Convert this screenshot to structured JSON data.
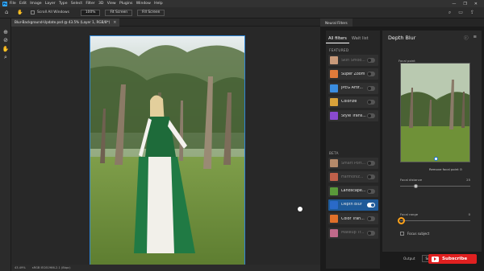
{
  "menubar": {
    "logo": "Ps",
    "items": [
      "File",
      "Edit",
      "Image",
      "Layer",
      "Type",
      "Select",
      "Filter",
      "3D",
      "View",
      "Plugins",
      "Window",
      "Help"
    ],
    "window_controls": [
      "—",
      "❐",
      "✕"
    ]
  },
  "options": {
    "scroll_all_label": "Scroll All Windows",
    "zoom_value": "100%",
    "fit_screen_label": "Fit Screen",
    "fill_screen_label": "Fill Screen"
  },
  "document": {
    "tab_title": "Blur-Background-Update.psd @ 43.5% (Layer 1, RGB/8*)",
    "close": "×"
  },
  "status": {
    "zoom": "43.49%",
    "profile": "sRGB IEC61966-2.1 (8bpc)"
  },
  "neural_filters": {
    "panel_tab": "Neural Filters",
    "tabs": [
      "All filters",
      "Wait list"
    ],
    "featured_label": "FEATURED",
    "beta_label": "BETA",
    "featured": [
      {
        "label": "Skin Smoo...",
        "enabled": false,
        "dim": true,
        "color": "#c99a7a"
      },
      {
        "label": "Super Zoom",
        "enabled": false,
        "dim": false,
        "color": "#e07b3a"
      },
      {
        "label": "JPEG Artif...",
        "enabled": false,
        "dim": false,
        "color": "#3a8de0"
      },
      {
        "label": "Colorize",
        "enabled": false,
        "dim": false,
        "color": "#d9a23a"
      },
      {
        "label": "Style Trans...",
        "enabled": false,
        "dim": false,
        "color": "#8a4ad0"
      }
    ],
    "beta": [
      {
        "label": "Smart Port...",
        "enabled": false,
        "dim": true,
        "color": "#b58a6a"
      },
      {
        "label": "Harmoniz...",
        "enabled": false,
        "dim": true,
        "color": "#c0604a"
      },
      {
        "label": "Landscape...",
        "enabled": false,
        "dim": false,
        "color": "#5a9a3a"
      },
      {
        "label": "Depth Blur",
        "enabled": true,
        "dim": false,
        "color": "#2a6ac8"
      },
      {
        "label": "Color Tran...",
        "enabled": false,
        "dim": false,
        "color": "#e0702a"
      },
      {
        "label": "Makeup Tr...",
        "enabled": false,
        "dim": true,
        "color": "#c06a8a"
      }
    ]
  },
  "depth_blur": {
    "title": "Depth Blur",
    "focal_point_label": "Focal point",
    "remove_focal_point": "Remove focal point",
    "focal_distance_label": "Focal distance",
    "focal_distance_value": "25",
    "focal_range_label": "Focal range",
    "focal_range_value": "0",
    "focus_subject_label": "Focus subject"
  },
  "output": {
    "label": "Output",
    "value": "Smart filter"
  },
  "subscribe": {
    "label": "Subscribe"
  }
}
